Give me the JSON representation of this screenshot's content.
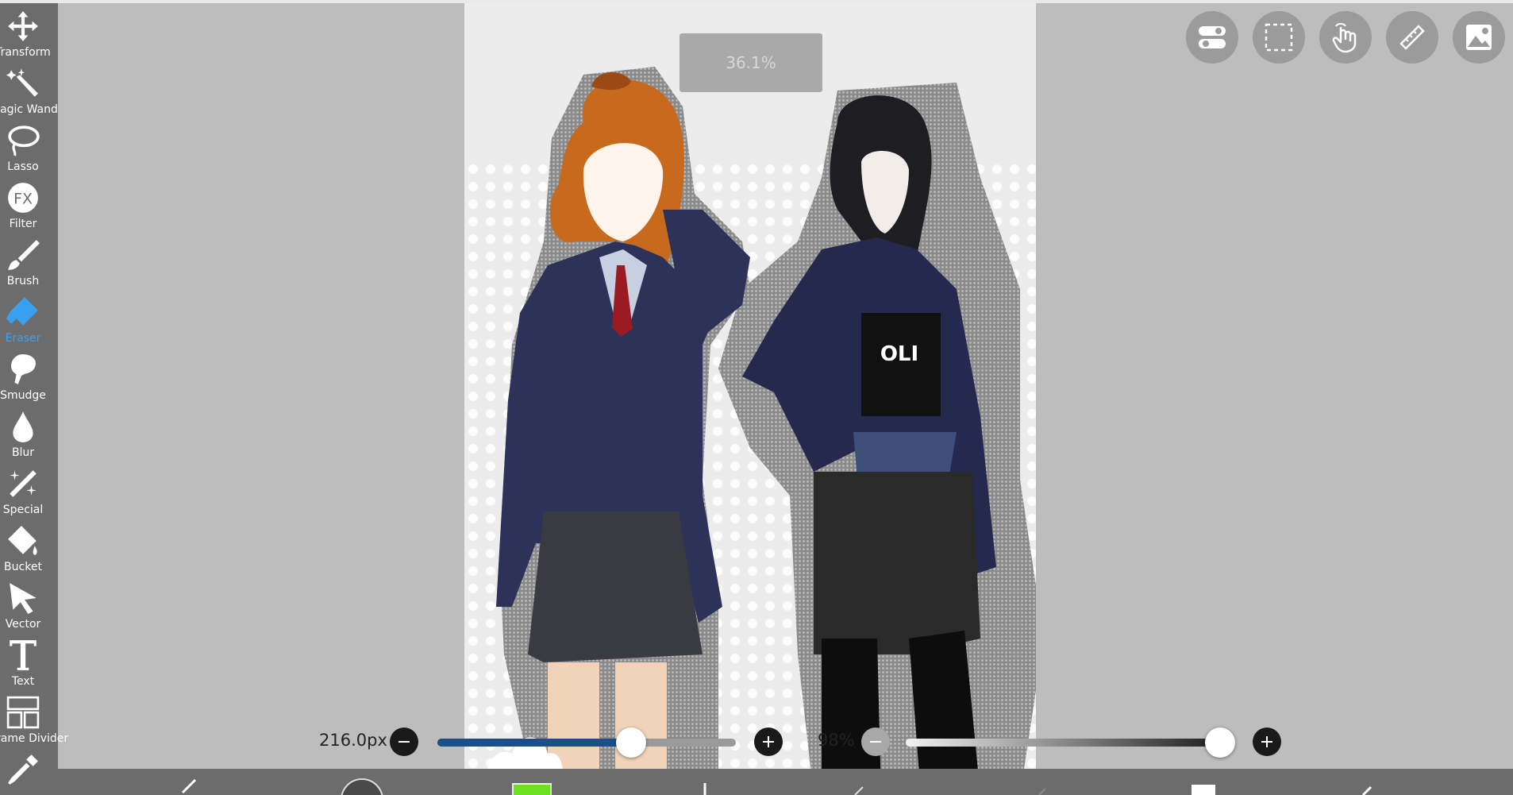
{
  "toolbar": {
    "tools": [
      {
        "label": "Transform",
        "icon": "transform-icon"
      },
      {
        "label": "Magic Wand",
        "icon": "magic-wand-icon"
      },
      {
        "label": "Lasso",
        "icon": "lasso-icon"
      },
      {
        "label": "Filter",
        "icon": "filter-fx-icon"
      },
      {
        "label": "Brush",
        "icon": "brush-icon"
      },
      {
        "label": "Eraser",
        "icon": "eraser-icon",
        "active": true
      },
      {
        "label": "Smudge",
        "icon": "smudge-icon"
      },
      {
        "label": "Blur",
        "icon": "blur-drop-icon"
      },
      {
        "label": "Special",
        "icon": "special-icon"
      },
      {
        "label": "Bucket",
        "icon": "bucket-icon"
      },
      {
        "label": "Vector",
        "icon": "vector-arrow-icon"
      },
      {
        "label": "Text",
        "icon": "text-icon"
      },
      {
        "label": "Frame Divider",
        "icon": "frame-divider-icon"
      }
    ],
    "active_color": "#39a0f0"
  },
  "canvas": {
    "zoom": "36.1%"
  },
  "controls": {
    "brush_size": "216.0px",
    "brush_size_fraction": 0.65,
    "opacity": "98%",
    "opacity_fraction": 0.98
  },
  "bottom_bar": {
    "color_swatch": "#6fe020"
  },
  "topright": [
    "toggle-settings-icon",
    "selection-icon",
    "hand-gesture-icon",
    "ruler-icon",
    "layer-image-icon"
  ]
}
